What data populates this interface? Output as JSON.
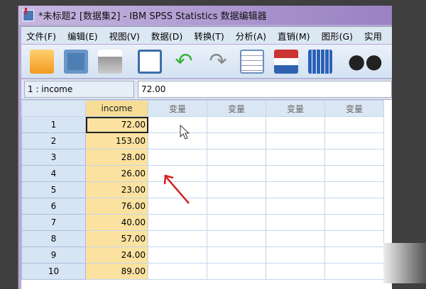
{
  "window": {
    "title": "*未标题2 [数据集2] - IBM SPSS Statistics 数据编辑器"
  },
  "menu": [
    "文件(F)",
    "编辑(E)",
    "视图(V)",
    "数据(D)",
    "转换(T)",
    "分析(A)",
    "直销(M)",
    "图形(G)",
    "实用"
  ],
  "toolbar": [
    "open-folder-icon",
    "save-icon",
    "print-icon",
    "recall-dialog-icon",
    "undo-icon",
    "redo-icon",
    "goto-case-icon",
    "goto-variable-icon",
    "variables-icon",
    "find-icon"
  ],
  "cellbar": {
    "ref": "1 : income",
    "value": "72.00"
  },
  "grid": {
    "headers": [
      "income",
      "变量",
      "变量",
      "变量",
      "变量"
    ],
    "rows": [
      [
        "1",
        "72.00"
      ],
      [
        "2",
        "153.00"
      ],
      [
        "3",
        "28.00"
      ],
      [
        "4",
        "26.00"
      ],
      [
        "5",
        "23.00"
      ],
      [
        "6",
        "76.00"
      ],
      [
        "7",
        "40.00"
      ],
      [
        "8",
        "57.00"
      ],
      [
        "9",
        "24.00"
      ],
      [
        "10",
        "89.00"
      ]
    ]
  }
}
